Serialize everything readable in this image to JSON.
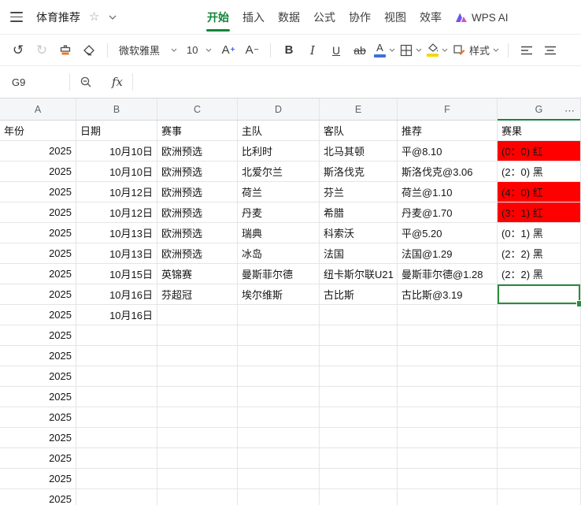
{
  "titlebar": {
    "title": "体育推荐",
    "tabs": [
      {
        "id": "home",
        "label": "开始",
        "active": true
      },
      {
        "id": "insert",
        "label": "插入"
      },
      {
        "id": "data",
        "label": "数据"
      },
      {
        "id": "formula",
        "label": "公式"
      },
      {
        "id": "collaborate",
        "label": "协作"
      },
      {
        "id": "view",
        "label": "视图"
      },
      {
        "id": "efficiency",
        "label": "效率"
      }
    ],
    "wps_ai_label": "WPS AI"
  },
  "toolbar": {
    "font_name": "微软雅黑",
    "font_size": "10",
    "increase_font_label": "A",
    "increase_font_sign": "+",
    "decrease_font_label": "A",
    "decrease_font_sign": "−",
    "bold_label": "B",
    "italic_label": "I",
    "underline_label": "U",
    "strikethrough_label": "ab",
    "font_color_label": "A",
    "style_label": "样式"
  },
  "formula_bar": {
    "cell_ref": "G9",
    "function_label": "fx"
  },
  "sheet": {
    "column_headers": [
      "A",
      "B",
      "C",
      "D",
      "E",
      "F",
      "G"
    ],
    "more_columns_label": "⋯",
    "selection": {
      "ref": "G9",
      "row_index": 8,
      "col_index": 6
    },
    "rows": [
      {
        "type": "header",
        "cells": [
          "年份",
          "日期",
          "赛事",
          "主队",
          "客队",
          "推荐",
          "赛果"
        ]
      },
      {
        "cells": [
          "2025",
          "10月10日",
          "欧洲预选",
          "比利时",
          "北马其顿",
          "平@8.10",
          "(0：0) 红"
        ],
        "red_result": true
      },
      {
        "cells": [
          "2025",
          "10月10日",
          "欧洲预选",
          "北爱尔兰",
          "斯洛伐克",
          "斯洛伐克@3.06",
          "(2：0) 黑"
        ]
      },
      {
        "cells": [
          "2025",
          "10月12日",
          "欧洲预选",
          "荷兰",
          "芬兰",
          "荷兰@1.10",
          "(4：0) 红"
        ],
        "red_result": true
      },
      {
        "cells": [
          "2025",
          "10月12日",
          "欧洲预选",
          "丹麦",
          "希腊",
          "丹麦@1.70",
          "(3：1) 红"
        ],
        "red_result": true
      },
      {
        "cells": [
          "2025",
          "10月13日",
          "欧洲预选",
          "瑞典",
          "科索沃",
          "平@5.20",
          "(0：1) 黑"
        ]
      },
      {
        "cells": [
          "2025",
          "10月13日",
          "欧洲预选",
          "冰岛",
          "法国",
          "法国@1.29",
          "(2：2) 黑"
        ]
      },
      {
        "cells": [
          "2025",
          "10月15日",
          "英锦赛",
          "曼斯菲尔德",
          "纽卡斯尔联U21",
          "曼斯菲尔德@1.28",
          "(2：2) 黑"
        ]
      },
      {
        "cells": [
          "2025",
          "10月16日",
          "芬超冠",
          "埃尔维斯",
          "古比斯",
          "古比斯@3.19",
          ""
        ]
      },
      {
        "cells": [
          "2025",
          "10月16日",
          "",
          "",
          "",
          "",
          ""
        ]
      },
      {
        "cells": [
          "2025",
          "",
          "",
          "",
          "",
          "",
          ""
        ]
      },
      {
        "cells": [
          "2025",
          "",
          "",
          "",
          "",
          "",
          ""
        ]
      },
      {
        "cells": [
          "2025",
          "",
          "",
          "",
          "",
          "",
          ""
        ]
      },
      {
        "cells": [
          "2025",
          "",
          "",
          "",
          "",
          "",
          ""
        ]
      },
      {
        "cells": [
          "2025",
          "",
          "",
          "",
          "",
          "",
          ""
        ]
      },
      {
        "cells": [
          "2025",
          "",
          "",
          "",
          "",
          "",
          ""
        ]
      },
      {
        "cells": [
          "2025",
          "",
          "",
          "",
          "",
          "",
          ""
        ]
      },
      {
        "cells": [
          "2025",
          "",
          "",
          "",
          "",
          "",
          ""
        ]
      },
      {
        "cells": [
          "2025",
          "",
          "",
          "",
          "",
          "",
          ""
        ]
      }
    ]
  },
  "colors": {
    "accent_green": "#15843c",
    "result_red": "#ff0000",
    "font_color_blue": "#3f6fd8",
    "fill_yellow": "#f7d600"
  }
}
